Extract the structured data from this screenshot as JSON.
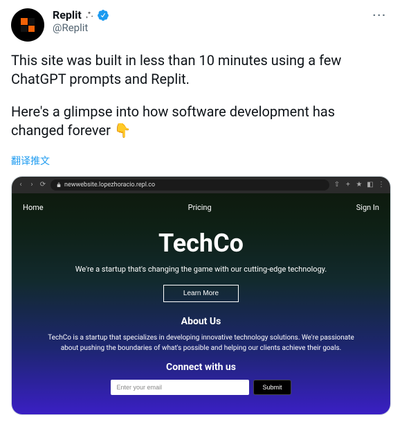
{
  "tweet": {
    "author_name": "Replit",
    "handle": "@Replit",
    "body_p1": "This site was built in less than 10 minutes using a few ChatGPT prompts and Replit.",
    "body_p2": "Here's a glimpse into how software development has changed forever",
    "emoji": "👇",
    "translate": "翻译推文",
    "more": "···"
  },
  "browser": {
    "url": "newwebsite.lopezhoracio.repl.co"
  },
  "site": {
    "nav": {
      "home": "Home",
      "pricing": "Pricing",
      "signin": "Sign In"
    },
    "hero": {
      "title": "TechCo",
      "tagline": "We're a startup that's changing the game with our cutting-edge technology.",
      "cta": "Learn More"
    },
    "about": {
      "heading": "About Us",
      "text": "TechCo is a startup that specializes in developing innovative technology solutions. We're passionate about pushing the boundaries of what's possible and helping our clients achieve their goals."
    },
    "connect": {
      "heading": "Connect with us",
      "placeholder": "Enter your email",
      "submit": "Submit"
    }
  }
}
